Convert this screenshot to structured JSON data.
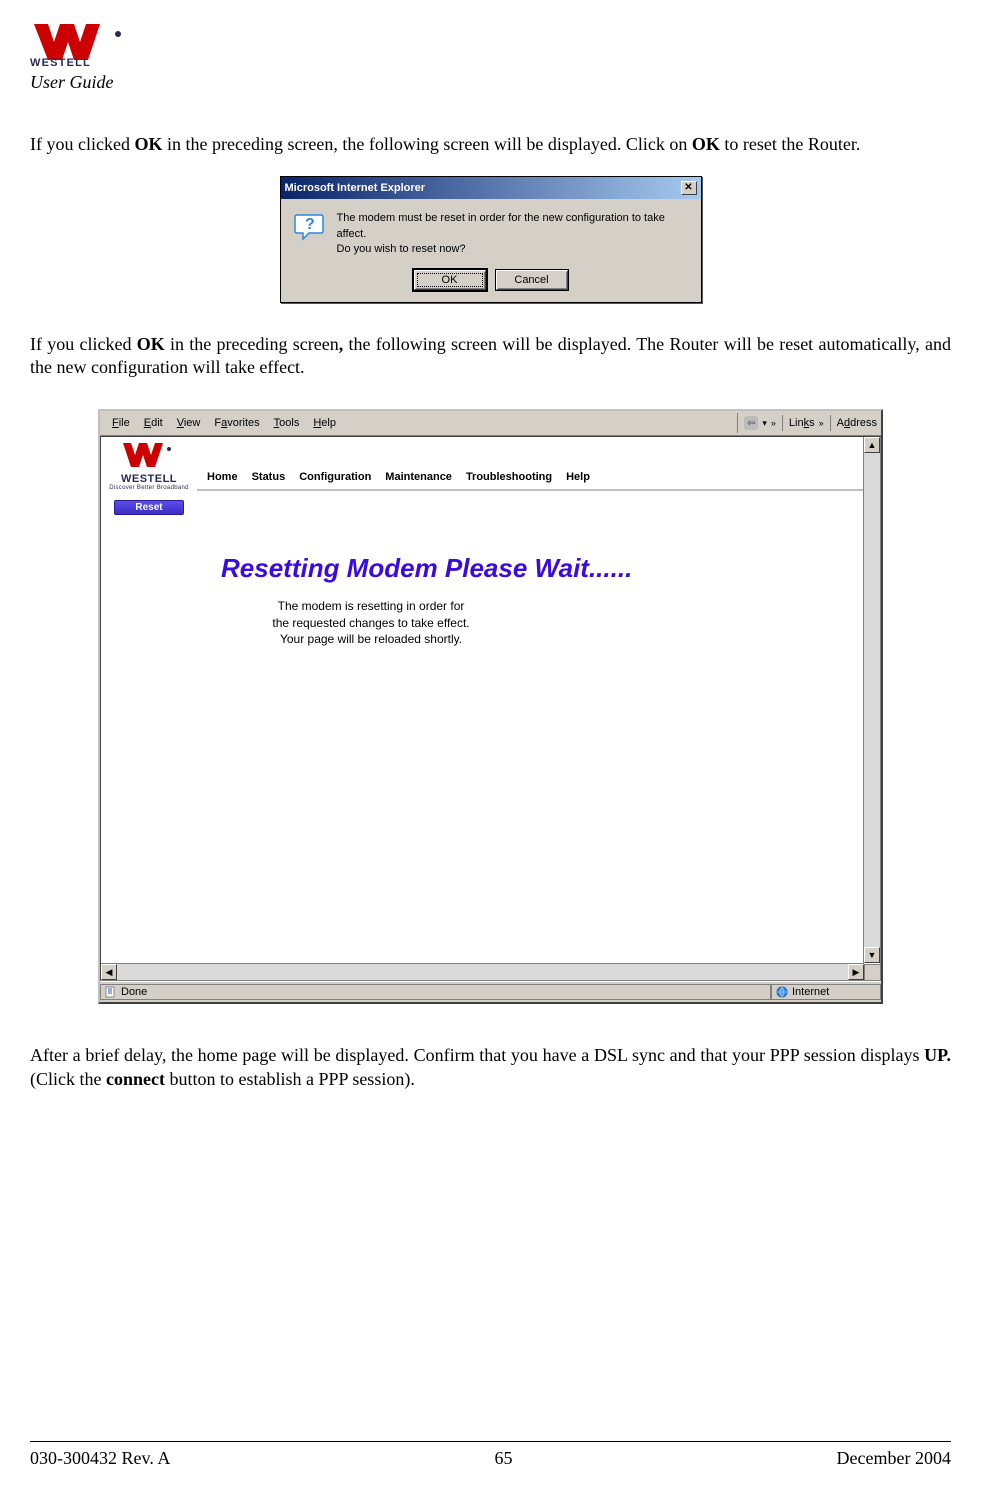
{
  "header": {
    "brand": "WESTELL",
    "section_title": "User Guide"
  },
  "paragraphs": {
    "p1_pre": "If you clicked ",
    "p1_bold1": "OK",
    "p1_mid": " in the preceding screen, the following screen will be displayed. Click on ",
    "p1_bold2": "OK",
    "p1_post": " to reset the Router.",
    "p2_pre": "If you clicked ",
    "p2_bold": "OK",
    "p2_mid": " in the preceding screen",
    "p2_comma": ",",
    "p2_post": " the following screen will be displayed. The Router will be reset automatically, and the new configuration will take effect.",
    "p3_pre": "After a brief delay, the home page will be displayed. Confirm that you have a DSL sync and that your PPP session displays ",
    "p3_bold1": "UP.",
    "p3_mid": " (Click the ",
    "p3_bold2": "connect",
    "p3_post": " button to establish a PPP session)."
  },
  "dialog1": {
    "title": "Microsoft Internet Explorer",
    "message_line1": "The modem must be reset in order for the new configuration to take affect.",
    "message_line2": "Do you wish to reset now?",
    "ok_label": "OK",
    "cancel_label": "Cancel",
    "close_glyph": "✕"
  },
  "browser": {
    "menus": {
      "file": "File",
      "edit": "Edit",
      "view": "View",
      "favorites": "Favorites",
      "tools": "Tools",
      "help": "Help"
    },
    "toolbar": {
      "back_glyph": "⇦",
      "dropdown_glyph": "▾",
      "chevrons": "»",
      "links_label": "Links",
      "address_label": "Address"
    },
    "sidebar": {
      "brand": "WESTELL",
      "tagline": "Discover Better Broadband",
      "reset_label": "Reset"
    },
    "navtabs": [
      "Home",
      "Status",
      "Configuration",
      "Maintenance",
      "Troubleshooting",
      "Help"
    ],
    "content": {
      "heading": "Resetting Modem Please Wait......",
      "msg_line1": "The modem is resetting in order for",
      "msg_line2": "the requested changes to take effect.",
      "msg_line3": "Your page will be reloaded shortly."
    },
    "statusbar": {
      "left": "Done",
      "right": "Internet"
    },
    "scroll": {
      "up": "▲",
      "down": "▼",
      "left": "◀",
      "right": "▶"
    }
  },
  "footer": {
    "left": "030-300432 Rev. A",
    "center": "65",
    "right": "December 2004"
  }
}
